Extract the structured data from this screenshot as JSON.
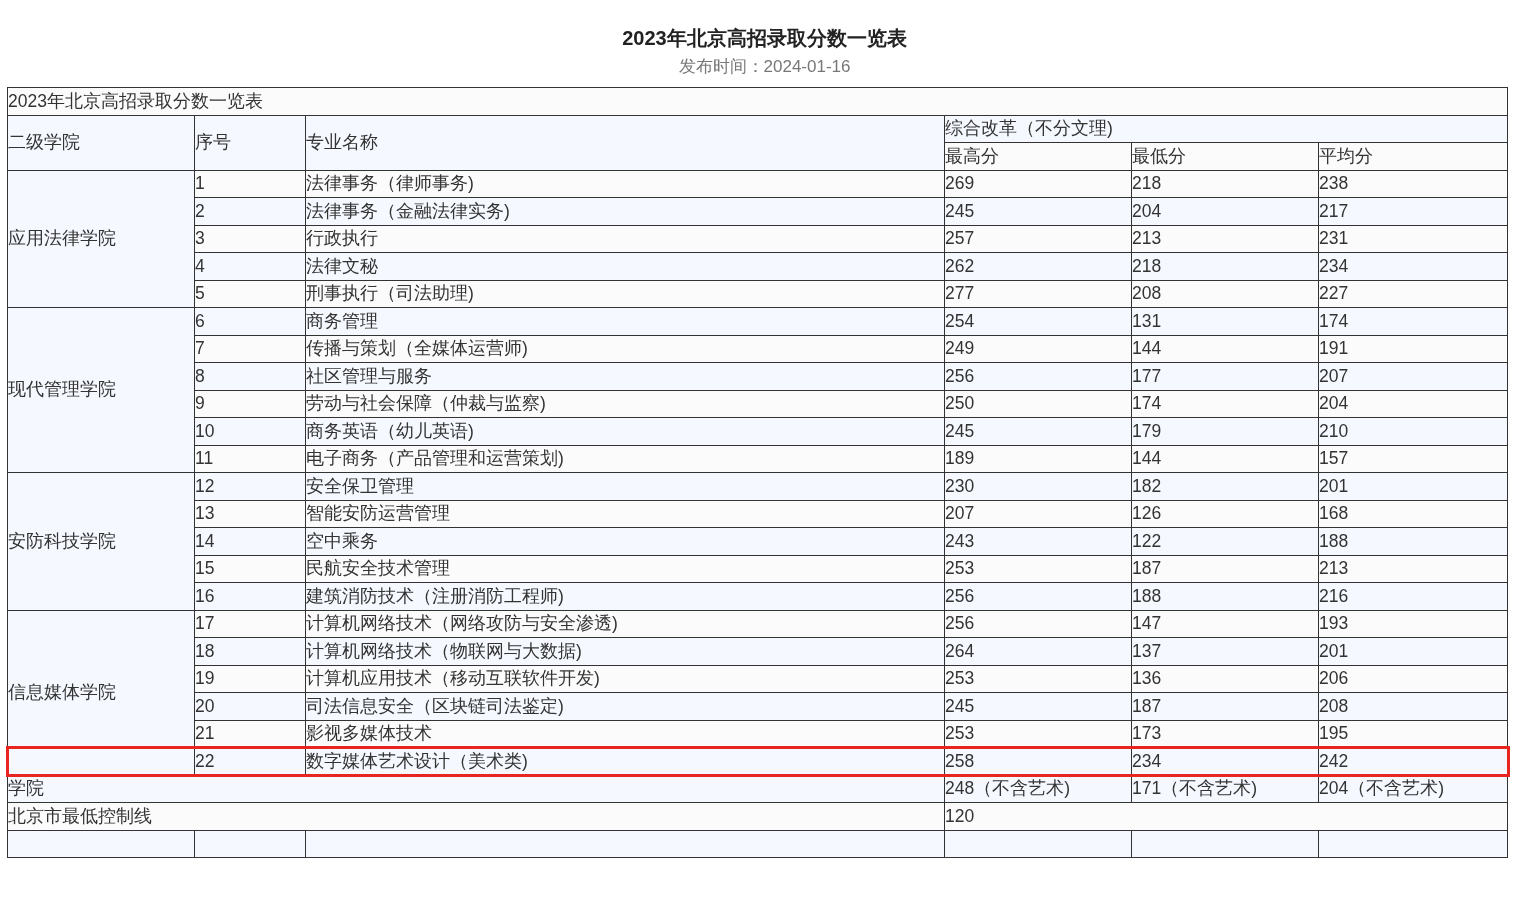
{
  "page": {
    "title": "2023年北京高招录取分数一览表",
    "published": "发布时间：2024-01-16"
  },
  "table": {
    "caption": "2023年北京高招录取分数一览表",
    "columns": {
      "college": "二级学院",
      "number": "序号",
      "major": "专业名称",
      "group": "综合改革（不分文理)",
      "max": "最高分",
      "min": "最低分",
      "avg": "平均分"
    },
    "groups": [
      {
        "college": "应用法律学院",
        "rows": [
          {
            "number": "1",
            "major": "法律事务（律师事务)",
            "max": "269",
            "min": "218",
            "avg": "238",
            "highlighted": false
          },
          {
            "number": "2",
            "major": "法律事务（金融法律实务)",
            "max": "245",
            "min": "204",
            "avg": "217",
            "highlighted": false
          },
          {
            "number": "3",
            "major": "行政执行",
            "max": "257",
            "min": "213",
            "avg": "231",
            "highlighted": false
          },
          {
            "number": "4",
            "major": "法律文秘",
            "max": "262",
            "min": "218",
            "avg": "234",
            "highlighted": false
          },
          {
            "number": "5",
            "major": "刑事执行（司法助理)",
            "max": "277",
            "min": "208",
            "avg": "227",
            "highlighted": false
          }
        ]
      },
      {
        "college": "现代管理学院",
        "rows": [
          {
            "number": "6",
            "major": "商务管理",
            "max": "254",
            "min": "131",
            "avg": "174",
            "highlighted": false
          },
          {
            "number": "7",
            "major": "传播与策划（全媒体运营师)",
            "max": "249",
            "min": "144",
            "avg": "191",
            "highlighted": false
          },
          {
            "number": "8",
            "major": "社区管理与服务",
            "max": "256",
            "min": "177",
            "avg": "207",
            "highlighted": false
          },
          {
            "number": "9",
            "major": "劳动与社会保障（仲裁与监察)",
            "max": "250",
            "min": "174",
            "avg": "204",
            "highlighted": false
          },
          {
            "number": "10",
            "major": "商务英语（幼儿英语)",
            "max": "245",
            "min": "179",
            "avg": "210",
            "highlighted": false
          },
          {
            "number": "11",
            "major": "电子商务（产品管理和运营策划)",
            "max": "189",
            "min": "144",
            "avg": "157",
            "highlighted": false
          }
        ]
      },
      {
        "college": "安防科技学院",
        "rows": [
          {
            "number": "12",
            "major": "安全保卫管理",
            "max": "230",
            "min": "182",
            "avg": "201",
            "highlighted": false
          },
          {
            "number": "13",
            "major": "智能安防运营管理",
            "max": "207",
            "min": "126",
            "avg": "168",
            "highlighted": false
          },
          {
            "number": "14",
            "major": "空中乘务",
            "max": "243",
            "min": "122",
            "avg": "188",
            "highlighted": false
          },
          {
            "number": "15",
            "major": "民航安全技术管理",
            "max": "253",
            "min": "187",
            "avg": "213",
            "highlighted": false
          },
          {
            "number": "16",
            "major": "建筑消防技术（注册消防工程师)",
            "max": "256",
            "min": "188",
            "avg": "216",
            "highlighted": false
          }
        ]
      },
      {
        "college": "信息媒体学院",
        "rows": [
          {
            "number": "17",
            "major": "计算机网络技术（网络攻防与安全渗透)",
            "max": "256",
            "min": "147",
            "avg": "193",
            "highlighted": false
          },
          {
            "number": "18",
            "major": "计算机网络技术（物联网与大数据)",
            "max": "264",
            "min": "137",
            "avg": "201",
            "highlighted": false
          },
          {
            "number": "19",
            "major": "计算机应用技术（移动互联软件开发)",
            "max": "253",
            "min": "136",
            "avg": "206",
            "highlighted": false
          },
          {
            "number": "20",
            "major": "司法信息安全（区块链司法鉴定)",
            "max": "245",
            "min": "187",
            "avg": "208",
            "highlighted": false
          },
          {
            "number": "21",
            "major": "影视多媒体技术",
            "max": "253",
            "min": "173",
            "avg": "195",
            "highlighted": false
          },
          {
            "number": "22",
            "major": "数字媒体艺术设计（美术类)",
            "max": "258",
            "min": "234",
            "avg": "242",
            "highlighted": true
          }
        ]
      }
    ],
    "school_row": {
      "label": "学院",
      "max": "248（不含艺术)",
      "min": "171（不含艺术)",
      "avg": "204（不含艺术)"
    },
    "control_row": {
      "label": "北京市最低控制线",
      "value": "120"
    }
  }
}
